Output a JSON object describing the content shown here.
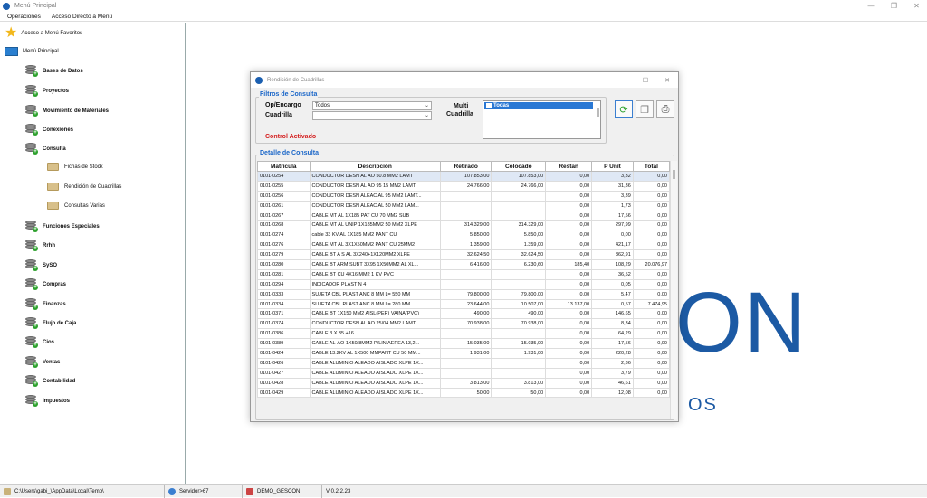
{
  "window": {
    "title": "Menú Principal"
  },
  "menu": {
    "items": [
      "Operaciones",
      "Acceso Directo a Menú"
    ]
  },
  "sidebar": {
    "favorites": "Acceso a Menú Favoritos",
    "root": "Menú Principal",
    "items": [
      "Bases de Datos",
      "Proyectos",
      "Movimiento de Materiales",
      "Conexiones",
      "Consulta",
      "Fichas de Stock",
      "Rendición  de  Cuadrillas",
      "Consultas Varias",
      "Funciones Especiales",
      "Rrhh",
      "SySO",
      "Compras",
      "Finanzas",
      "Flujo de Caja",
      "Cios",
      "Ventas",
      "Contabilidad",
      "Impuestos"
    ]
  },
  "background": {
    "logo_text": "ON",
    "logo_sub": "OS"
  },
  "dialog": {
    "title": "Rendición de Cuadrillas",
    "filters_title": "Filtros de Consulta",
    "op_label": "Op/Encargo",
    "op_value": "Todos",
    "cuadrilla_label": "Cuadrilla",
    "cuadrilla_value": "",
    "multi_label1": "Multi",
    "multi_label2": "Cuadrilla",
    "multi_item": "Todas",
    "control_text": "Control Activado",
    "detail_title": "Detalle de Consulta",
    "columns": [
      "Matricula",
      "Descripción",
      "Retirado",
      "Colocado",
      "Restan",
      "P Unit",
      "Total"
    ],
    "rows": [
      [
        "0101-0254",
        "CONDUCTOR DESN  AL AO 50.8 MM2 LAMT",
        "107.853,00",
        "107.853,00",
        "0,00",
        "3,32",
        "0,00"
      ],
      [
        "0101-0255",
        "CONDUCTOR DESN  AL AO 95 15 MM2 LAMT",
        "24.766,00",
        "24.766,00",
        "0,00",
        "31,36",
        "0,00"
      ],
      [
        "0101-0256",
        "CONDUCTOR DESN ALEAC AL 95 MM2 LAMT...",
        "",
        "",
        "0,00",
        "3,39",
        "0,00"
      ],
      [
        "0101-0261",
        "CONDUCTOR DESN  ALEAC  AL 50 MM2 LAM...",
        "",
        "",
        "0,00",
        "1,73",
        "0,00"
      ],
      [
        "0101-0267",
        "CABLE MT AL 1X185 PAT CU 70 MM2 SUB",
        "",
        "",
        "0,00",
        "17,56",
        "0,00"
      ],
      [
        "0101-0268",
        "CABLE MT AL UNIP 1X185MM2 50 MM2 XLPE",
        "314.329,00",
        "314.329,00",
        "0,00",
        "297,99",
        "0,00"
      ],
      [
        "0101-0274",
        "cable 33 KV AL 1X185 MM2 PANT CU",
        "5.850,00",
        "5.850,00",
        "0,00",
        "0,00",
        "0,00"
      ],
      [
        "0101-0276",
        "CABLE MT AL 3X1X50MM2 PANT CU 25MM2",
        "1.359,00",
        "1.359,00",
        "0,00",
        "421,17",
        "0,00"
      ],
      [
        "0101-0279",
        "CABLE BT A S AL 3X240+1X120MM2 XLPE",
        "32.624,50",
        "32.624,50",
        "0,00",
        "362,91",
        "0,00"
      ],
      [
        "0101-0280",
        "CABLE BT ARM SUBT 3X95  1X50MM2 AL XL...",
        "6.416,00",
        "6.230,60",
        "185,40",
        "108,29",
        "20.076,97"
      ],
      [
        "0101-0281",
        "CABLE BT CU 4X16 MM2 1 KV PVC",
        "",
        "",
        "0,00",
        "36,52",
        "0,00"
      ],
      [
        "0101-0294",
        "INDICADOR PLAST N  4",
        "",
        "",
        "0,00",
        "0,05",
        "0,00"
      ],
      [
        "0101-0333",
        "SUJETA CBL PLAST ANC 8 MM L= 550 MM",
        "79.800,00",
        "79.800,00",
        "0,00",
        "5,47",
        "0,00"
      ],
      [
        "0101-0334",
        "SUJETA CBL PLAST ANC 8 MM L= 280 MM",
        "23.644,00",
        "10.507,00",
        "13.137,00",
        "0,57",
        "7.474,95"
      ],
      [
        "0101-0371",
        "CABLE BT 1X150 MM2 AISL(PER) VAINA(PVC)",
        "490,00",
        "490,00",
        "0,00",
        "146,65",
        "0,00"
      ],
      [
        "0101-0374",
        "CONDUCTOR DESN  AL AO 25/04 MM2 LAMT...",
        "70.938,00",
        "70.938,00",
        "0,00",
        "8,34",
        "0,00"
      ],
      [
        "0101-0386",
        "CABLE 3 X 35 +16",
        "",
        "",
        "0,00",
        "64,29",
        "0,00"
      ],
      [
        "0101-0389",
        "CABLE AL-AO 1X50/8MM2 P/LIN AEREA 13,2...",
        "15.035,00",
        "15.035,00",
        "0,00",
        "17,56",
        "0,00"
      ],
      [
        "0101-0424",
        "CABLE 13.2KV AL 1X500 MMPANT CU 50 MM...",
        "1.931,00",
        "1.931,00",
        "0,00",
        "220,28",
        "0,00"
      ],
      [
        "0101-0426",
        "CABLE ALUMINIO ALEADO AISLADO XLPE 1X...",
        "",
        "",
        "0,00",
        "2,36",
        "0,00"
      ],
      [
        "0101-0427",
        "CABLE ALUMINIO ALEADO AISLADO XLPE 1X...",
        "",
        "",
        "0,00",
        "3,79",
        "0,00"
      ],
      [
        "0101-0428",
        "CABLE ALUMINIO ALEADO AISLADO XLPE 1X...",
        "3.813,00",
        "3.813,00",
        "0,00",
        "46,61",
        "0,00"
      ],
      [
        "0101-0429",
        "CABLE ALUMINIO ALEADO AISLADO XLPE 1X...",
        "50,00",
        "50,00",
        "0,00",
        "12,08",
        "0,00"
      ]
    ]
  },
  "statusbar": {
    "path": "C:\\Users\\gabi_\\AppData\\Local\\Temp\\",
    "server": "Servidor>67",
    "db": "DEMO_GESCON",
    "version": "V 0.2.2.23"
  },
  "colors": {
    "accent": "#1a66c8",
    "logo": "#1c5aa4",
    "control": "#d42020"
  }
}
